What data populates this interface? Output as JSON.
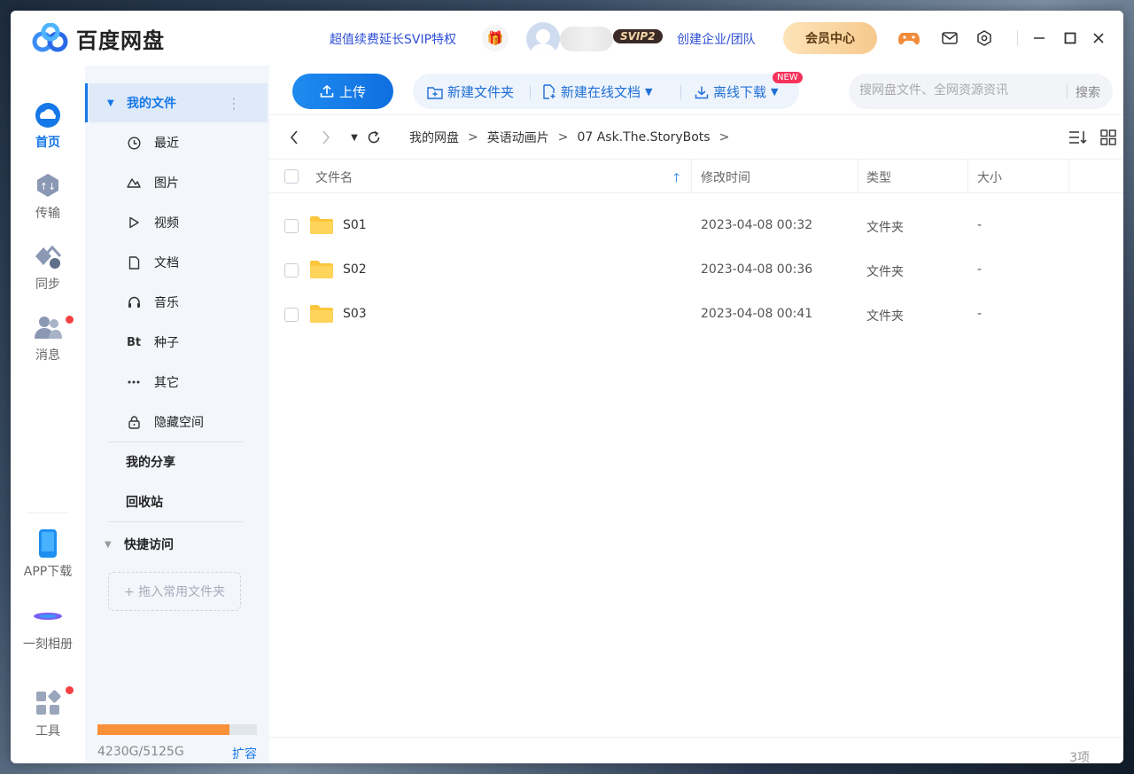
{
  "app": {
    "brand": "百度网盘",
    "promo": "超值续费延长SVIP特权",
    "svip_badge": "SVIP2",
    "enterprise": "创建企业/团队",
    "member_center": "会员中心"
  },
  "rail": {
    "items": [
      {
        "label": "首页",
        "icon": "cloud-icon",
        "active": true
      },
      {
        "label": "传输",
        "icon": "transfer-icon"
      },
      {
        "label": "同步",
        "icon": "sync-icon"
      },
      {
        "label": "消息",
        "icon": "message-icon",
        "badge": true
      }
    ],
    "bottom": [
      {
        "label": "APP下载",
        "icon": "phone-icon"
      },
      {
        "label": "一刻相册",
        "icon": "album-icon"
      },
      {
        "label": "工具",
        "icon": "tools-icon",
        "badge": true
      }
    ]
  },
  "sidebar": {
    "my_files": "我的文件",
    "items": [
      {
        "label": "最近",
        "icon": "clock-icon"
      },
      {
        "label": "图片",
        "icon": "image-icon"
      },
      {
        "label": "视频",
        "icon": "play-icon"
      },
      {
        "label": "文档",
        "icon": "document-icon"
      },
      {
        "label": "音乐",
        "icon": "headphone-icon"
      },
      {
        "label": "种子",
        "icon": "bt-icon",
        "glyph": "Bt"
      },
      {
        "label": "其它",
        "icon": "more-icon"
      },
      {
        "label": "隐藏空间",
        "icon": "lock-icon"
      }
    ],
    "my_share": "我的分享",
    "recycle": "回收站",
    "quick_access": "快捷访问",
    "drop_hint": "+ 拖入常用文件夹",
    "quota": {
      "used_gb": 4230,
      "total_gb": 5125,
      "text": "4230G/5125G",
      "expand": "扩容"
    }
  },
  "toolbar": {
    "upload": "上传",
    "new_folder": "新建文件夹",
    "new_doc": "新建在线文档",
    "new_badge": "NEW",
    "offline": "离线下载",
    "search_placeholder": "搜网盘文件、全网资源资讯",
    "search_btn": "搜索"
  },
  "breadcrumb": [
    "我的网盘",
    "英语动画片",
    "07 Ask.The.StoryBots"
  ],
  "table": {
    "headers": {
      "name": "文件名",
      "mtime": "修改时间",
      "type": "类型",
      "size": "大小"
    },
    "rows": [
      {
        "name": "S01",
        "mtime": "2023-04-08 00:32",
        "type": "文件夹",
        "size": "-"
      },
      {
        "name": "S02",
        "mtime": "2023-04-08 00:36",
        "type": "文件夹",
        "size": "-"
      },
      {
        "name": "S03",
        "mtime": "2023-04-08 00:41",
        "type": "文件夹",
        "size": "-"
      }
    ]
  },
  "footer": {
    "count": "3项"
  },
  "colors": {
    "accent": "#1677e8",
    "quota": "#f9903a",
    "folder": "#fcc73d"
  }
}
